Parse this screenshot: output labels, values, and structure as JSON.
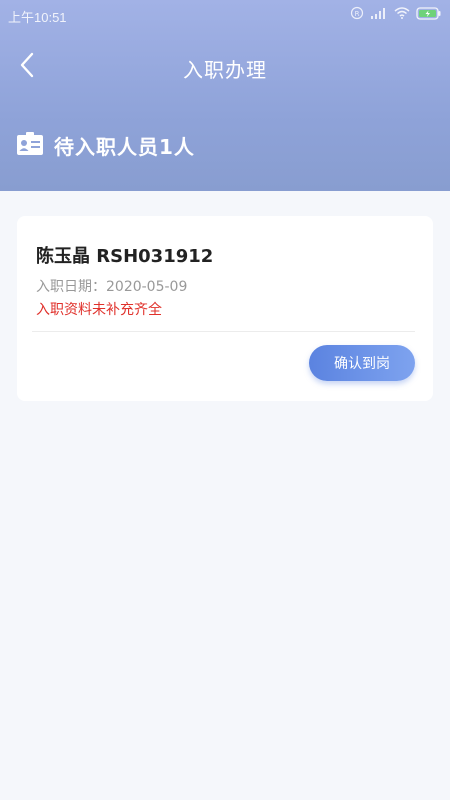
{
  "status_bar": {
    "time": "上午10:51",
    "icons": [
      "alarm-icon",
      "signal-icon",
      "wifi-icon",
      "battery-charging-icon"
    ]
  },
  "nav": {
    "back_icon": "chevron-left-icon",
    "title": "入职办理"
  },
  "summary": {
    "icon": "id-card-icon",
    "text": "待入职人员1人"
  },
  "cards": [
    {
      "name": "陈玉晶 RSH031912",
      "date_label": "入职日期：2020-05-09",
      "warning": "入职资料未补充齐全",
      "action_label": "确认到岗"
    }
  ],
  "colors": {
    "header_gradient_top": "#a2b2e6",
    "header_gradient_bottom": "#889dd0",
    "warning": "#e0312b",
    "button_start": "#5b83e0",
    "button_end": "#7ea3ef",
    "background": "#f5f7fb"
  }
}
